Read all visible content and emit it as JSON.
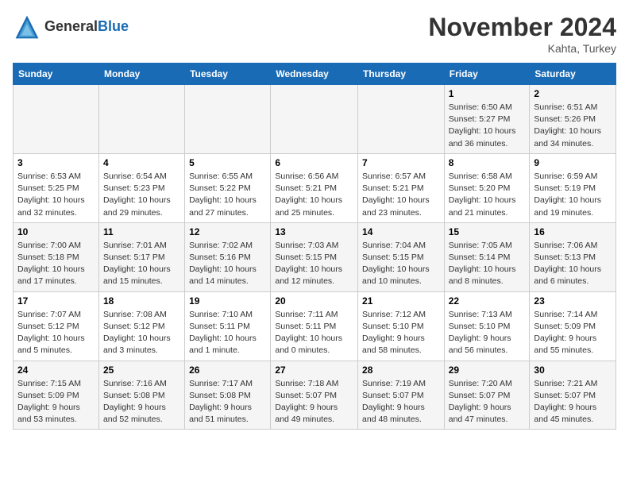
{
  "header": {
    "logo_line1": "General",
    "logo_line2": "Blue",
    "month": "November 2024",
    "location": "Kahta, Turkey"
  },
  "weekdays": [
    "Sunday",
    "Monday",
    "Tuesday",
    "Wednesday",
    "Thursday",
    "Friday",
    "Saturday"
  ],
  "weeks": [
    [
      {
        "day": "",
        "info": ""
      },
      {
        "day": "",
        "info": ""
      },
      {
        "day": "",
        "info": ""
      },
      {
        "day": "",
        "info": ""
      },
      {
        "day": "",
        "info": ""
      },
      {
        "day": "1",
        "info": "Sunrise: 6:50 AM\nSunset: 5:27 PM\nDaylight: 10 hours\nand 36 minutes."
      },
      {
        "day": "2",
        "info": "Sunrise: 6:51 AM\nSunset: 5:26 PM\nDaylight: 10 hours\nand 34 minutes."
      }
    ],
    [
      {
        "day": "3",
        "info": "Sunrise: 6:53 AM\nSunset: 5:25 PM\nDaylight: 10 hours\nand 32 minutes."
      },
      {
        "day": "4",
        "info": "Sunrise: 6:54 AM\nSunset: 5:23 PM\nDaylight: 10 hours\nand 29 minutes."
      },
      {
        "day": "5",
        "info": "Sunrise: 6:55 AM\nSunset: 5:22 PM\nDaylight: 10 hours\nand 27 minutes."
      },
      {
        "day": "6",
        "info": "Sunrise: 6:56 AM\nSunset: 5:21 PM\nDaylight: 10 hours\nand 25 minutes."
      },
      {
        "day": "7",
        "info": "Sunrise: 6:57 AM\nSunset: 5:21 PM\nDaylight: 10 hours\nand 23 minutes."
      },
      {
        "day": "8",
        "info": "Sunrise: 6:58 AM\nSunset: 5:20 PM\nDaylight: 10 hours\nand 21 minutes."
      },
      {
        "day": "9",
        "info": "Sunrise: 6:59 AM\nSunset: 5:19 PM\nDaylight: 10 hours\nand 19 minutes."
      }
    ],
    [
      {
        "day": "10",
        "info": "Sunrise: 7:00 AM\nSunset: 5:18 PM\nDaylight: 10 hours\nand 17 minutes."
      },
      {
        "day": "11",
        "info": "Sunrise: 7:01 AM\nSunset: 5:17 PM\nDaylight: 10 hours\nand 15 minutes."
      },
      {
        "day": "12",
        "info": "Sunrise: 7:02 AM\nSunset: 5:16 PM\nDaylight: 10 hours\nand 14 minutes."
      },
      {
        "day": "13",
        "info": "Sunrise: 7:03 AM\nSunset: 5:15 PM\nDaylight: 10 hours\nand 12 minutes."
      },
      {
        "day": "14",
        "info": "Sunrise: 7:04 AM\nSunset: 5:15 PM\nDaylight: 10 hours\nand 10 minutes."
      },
      {
        "day": "15",
        "info": "Sunrise: 7:05 AM\nSunset: 5:14 PM\nDaylight: 10 hours\nand 8 minutes."
      },
      {
        "day": "16",
        "info": "Sunrise: 7:06 AM\nSunset: 5:13 PM\nDaylight: 10 hours\nand 6 minutes."
      }
    ],
    [
      {
        "day": "17",
        "info": "Sunrise: 7:07 AM\nSunset: 5:12 PM\nDaylight: 10 hours\nand 5 minutes."
      },
      {
        "day": "18",
        "info": "Sunrise: 7:08 AM\nSunset: 5:12 PM\nDaylight: 10 hours\nand 3 minutes."
      },
      {
        "day": "19",
        "info": "Sunrise: 7:10 AM\nSunset: 5:11 PM\nDaylight: 10 hours\nand 1 minute."
      },
      {
        "day": "20",
        "info": "Sunrise: 7:11 AM\nSunset: 5:11 PM\nDaylight: 10 hours\nand 0 minutes."
      },
      {
        "day": "21",
        "info": "Sunrise: 7:12 AM\nSunset: 5:10 PM\nDaylight: 9 hours\nand 58 minutes."
      },
      {
        "day": "22",
        "info": "Sunrise: 7:13 AM\nSunset: 5:10 PM\nDaylight: 9 hours\nand 56 minutes."
      },
      {
        "day": "23",
        "info": "Sunrise: 7:14 AM\nSunset: 5:09 PM\nDaylight: 9 hours\nand 55 minutes."
      }
    ],
    [
      {
        "day": "24",
        "info": "Sunrise: 7:15 AM\nSunset: 5:09 PM\nDaylight: 9 hours\nand 53 minutes."
      },
      {
        "day": "25",
        "info": "Sunrise: 7:16 AM\nSunset: 5:08 PM\nDaylight: 9 hours\nand 52 minutes."
      },
      {
        "day": "26",
        "info": "Sunrise: 7:17 AM\nSunset: 5:08 PM\nDaylight: 9 hours\nand 51 minutes."
      },
      {
        "day": "27",
        "info": "Sunrise: 7:18 AM\nSunset: 5:07 PM\nDaylight: 9 hours\nand 49 minutes."
      },
      {
        "day": "28",
        "info": "Sunrise: 7:19 AM\nSunset: 5:07 PM\nDaylight: 9 hours\nand 48 minutes."
      },
      {
        "day": "29",
        "info": "Sunrise: 7:20 AM\nSunset: 5:07 PM\nDaylight: 9 hours\nand 47 minutes."
      },
      {
        "day": "30",
        "info": "Sunrise: 7:21 AM\nSunset: 5:07 PM\nDaylight: 9 hours\nand 45 minutes."
      }
    ]
  ]
}
